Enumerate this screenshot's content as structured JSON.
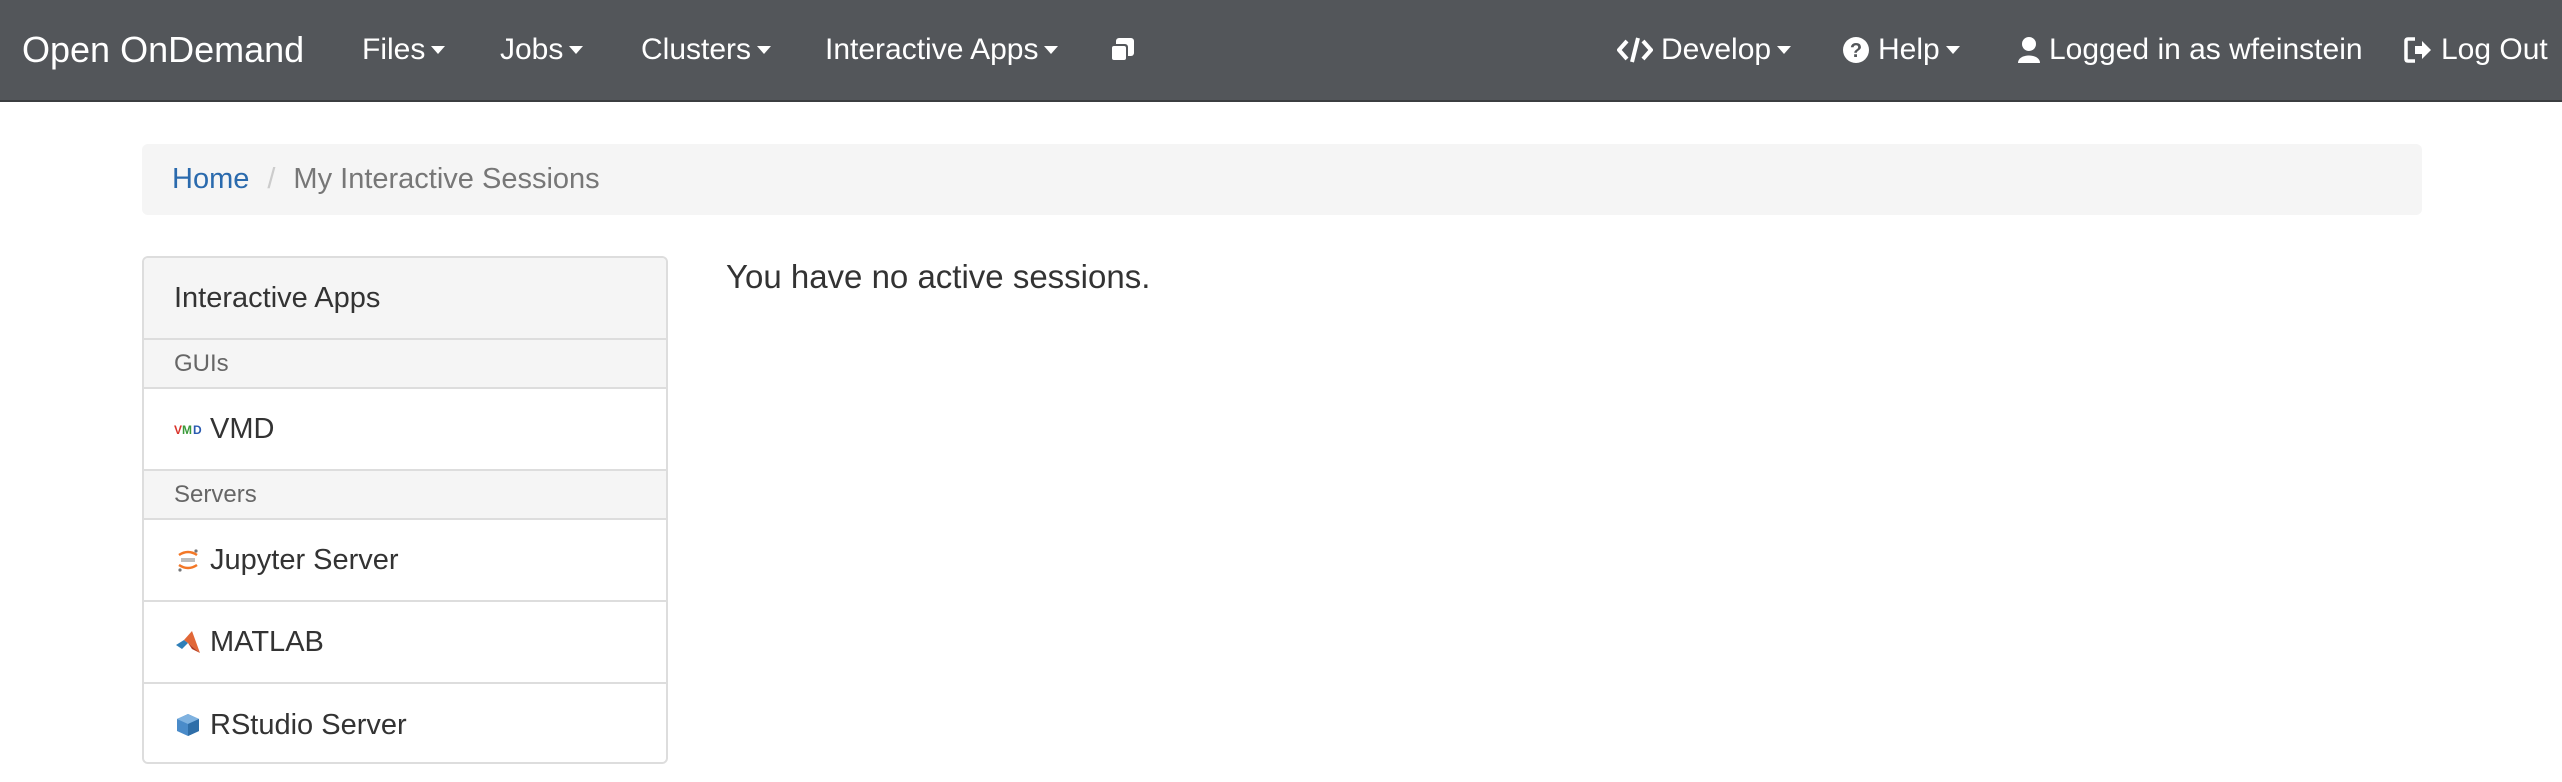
{
  "navbar": {
    "brand": "Open OnDemand",
    "menus": {
      "files": "Files",
      "jobs": "Jobs",
      "clusters": "Clusters",
      "interactive_apps": "Interactive Apps",
      "develop": "Develop",
      "help": "Help"
    },
    "user_label": "Logged in as wfeinstein",
    "logout": "Log Out",
    "icons": {
      "sessions": "clone-icon",
      "develop": "code-icon",
      "help": "question-circle-icon",
      "user": "user-icon",
      "logout": "sign-out-icon"
    }
  },
  "breadcrumb": {
    "home": "Home",
    "separator": "/",
    "current": "My Interactive Sessions"
  },
  "sidebar": {
    "title": "Interactive Apps",
    "groups": [
      {
        "name": "GUIs",
        "apps": [
          {
            "label": "VMD",
            "icon": "vmd-icon"
          }
        ]
      },
      {
        "name": "Servers",
        "apps": [
          {
            "label": "Jupyter Server",
            "icon": "jupyter-icon"
          },
          {
            "label": "MATLAB",
            "icon": "matlab-icon"
          },
          {
            "label": "RStudio Server",
            "icon": "rstudio-icon"
          }
        ]
      }
    ]
  },
  "main": {
    "message": "You have no active sessions."
  },
  "colors": {
    "navbar_bg": "#53565a",
    "link": "#2a6aad",
    "panel_bg": "#f5f5f5",
    "border": "#dddddd"
  }
}
